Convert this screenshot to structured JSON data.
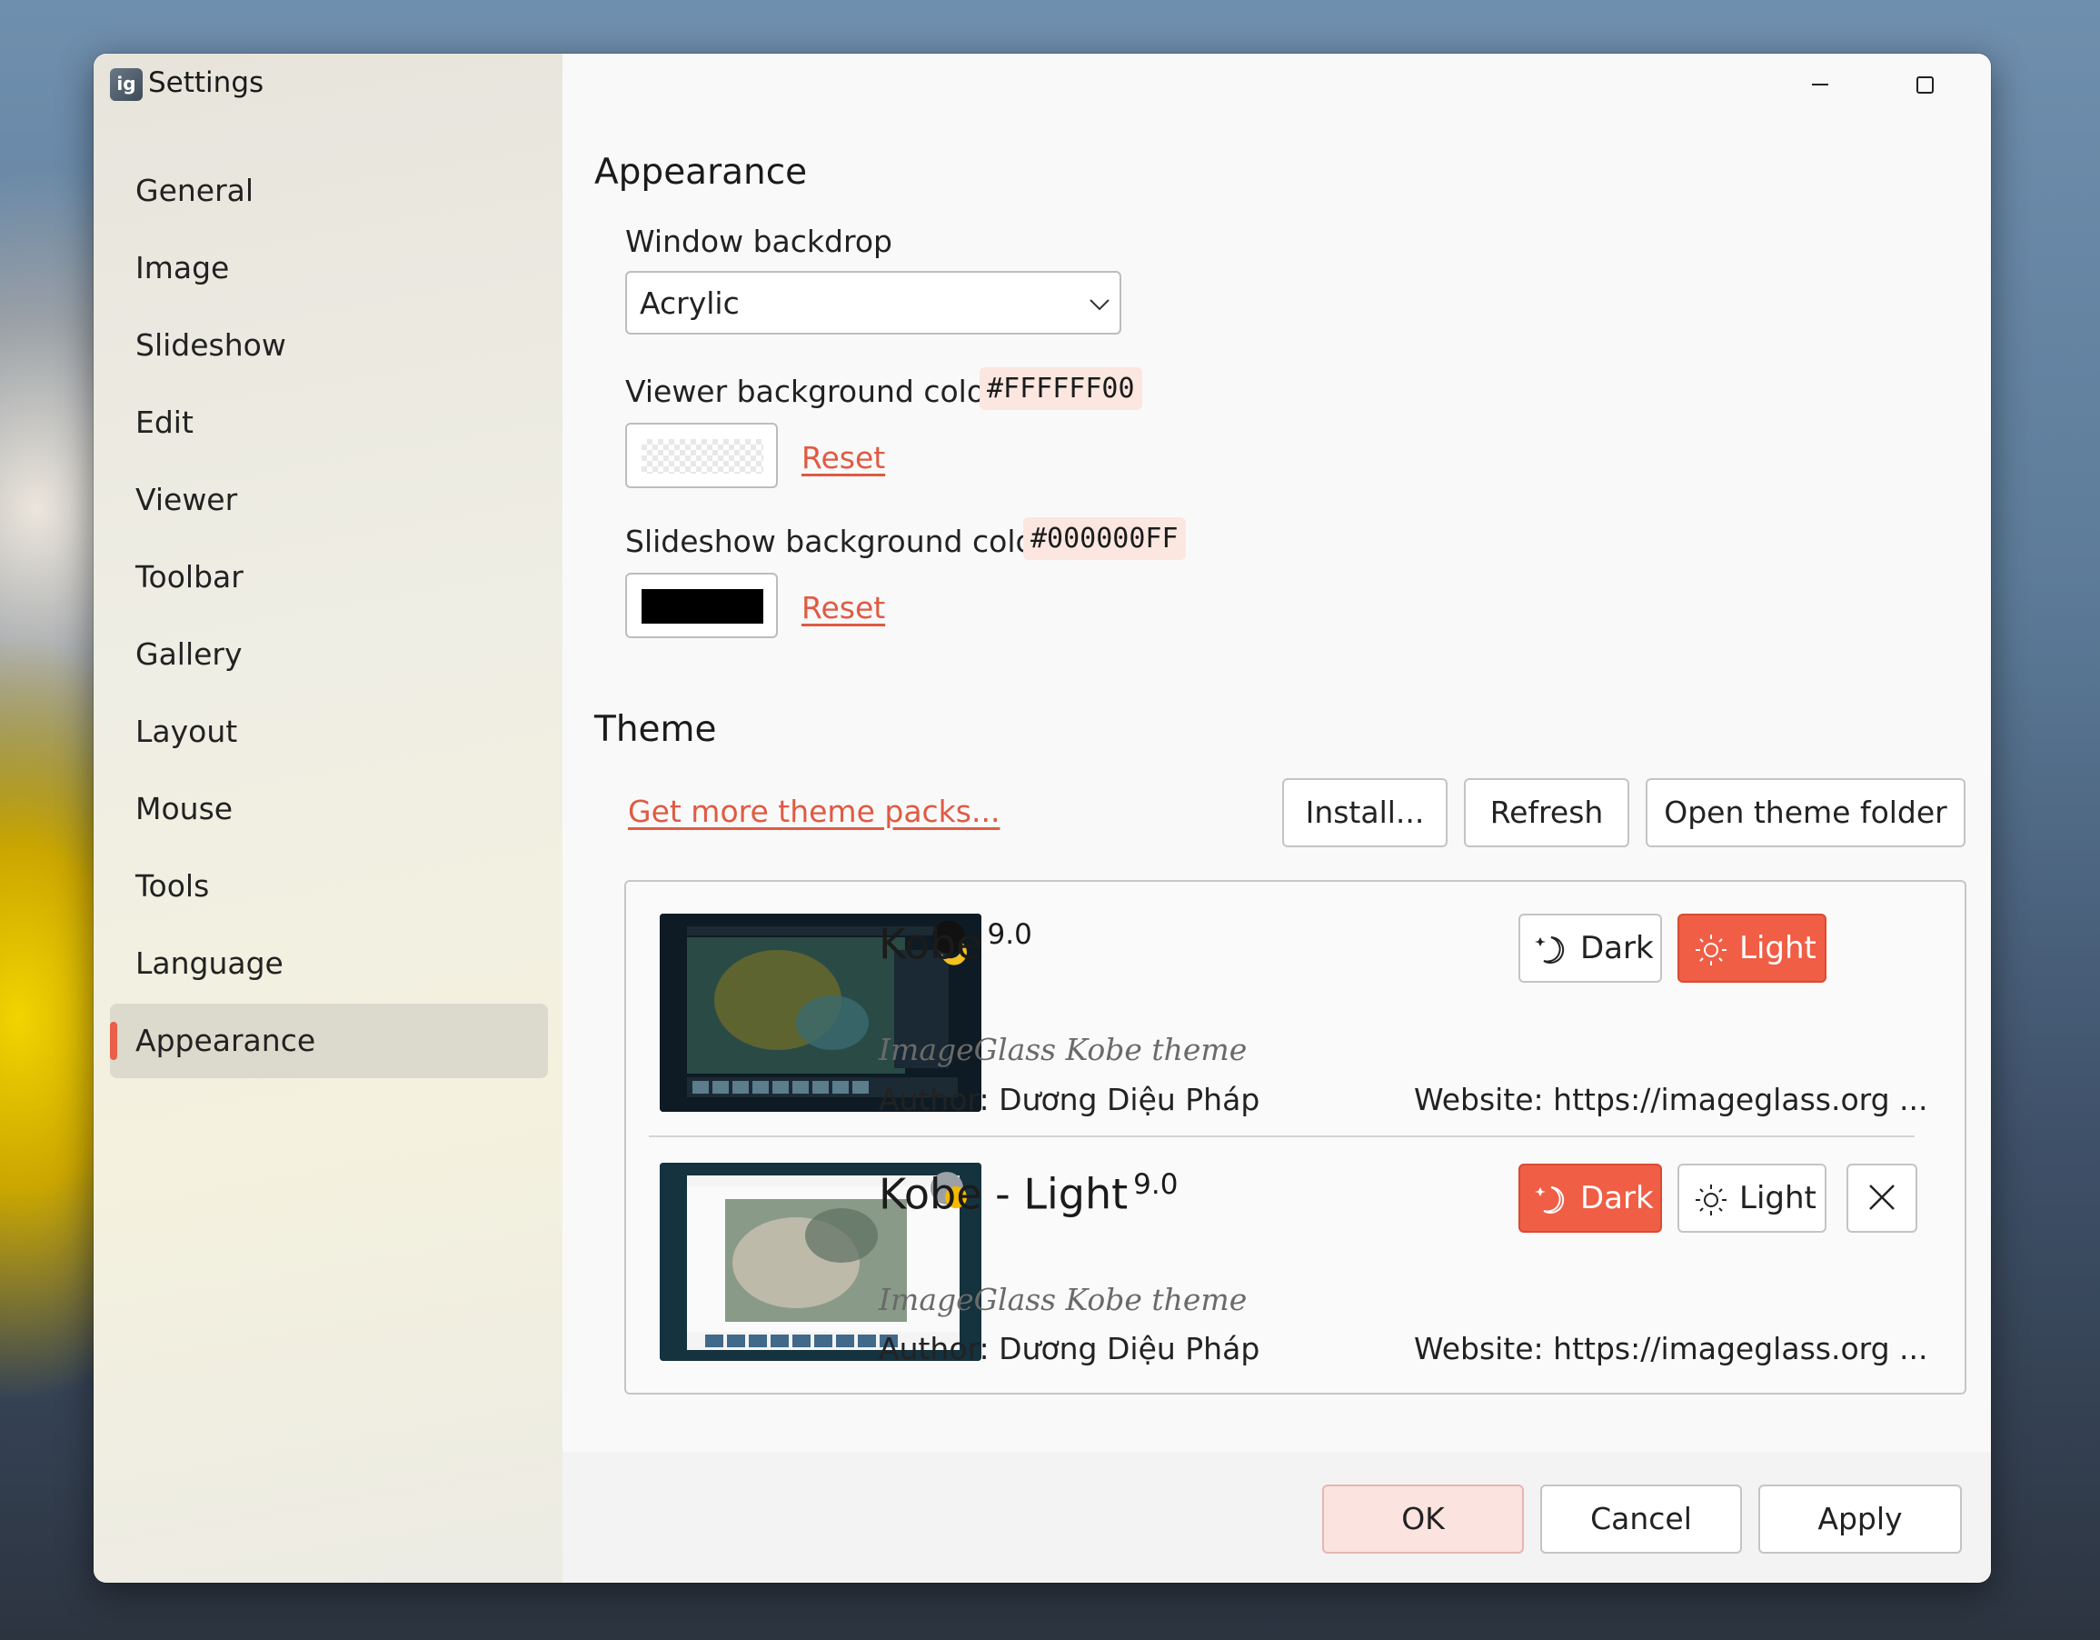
{
  "window": {
    "title": "Settings",
    "app_icon_text": "ig"
  },
  "sidebar": {
    "items": [
      {
        "label": "General"
      },
      {
        "label": "Image"
      },
      {
        "label": "Slideshow"
      },
      {
        "label": "Edit"
      },
      {
        "label": "Viewer"
      },
      {
        "label": "Toolbar"
      },
      {
        "label": "Gallery"
      },
      {
        "label": "Layout"
      },
      {
        "label": "Mouse"
      },
      {
        "label": "Tools"
      },
      {
        "label": "Language"
      },
      {
        "label": "Appearance",
        "active": true
      }
    ]
  },
  "appearance": {
    "heading": "Appearance",
    "backdrop_label": "Window backdrop",
    "backdrop_value": "Acrylic",
    "viewer_bg_label": "Viewer background color",
    "viewer_bg_value": "#FFFFFF00",
    "slideshow_bg_label": "Slideshow background color",
    "slideshow_bg_value": "#000000FF",
    "reset_label": "Reset"
  },
  "theme": {
    "heading": "Theme",
    "get_more_link": "Get more theme packs...",
    "install_button": "Install...",
    "refresh_button": "Refresh",
    "open_folder_button": "Open theme folder",
    "packs": [
      {
        "name": "Kobe",
        "version": "9.0",
        "description": "ImageGlass Kobe theme",
        "author": "Author: Dương Diệu Pháp",
        "website": "Website: https://imageglass.org ...",
        "dark_label": "Dark",
        "light_label": "Light",
        "active_mode": "light"
      },
      {
        "name": "Kobe - Light",
        "version": "9.0",
        "description": "ImageGlass Kobe theme",
        "author": "Author: Dương Diệu Pháp",
        "website": "Website: https://imageglass.org ...",
        "dark_label": "Dark",
        "light_label": "Light",
        "active_mode": "dark"
      }
    ]
  },
  "footer": {
    "ok": "OK",
    "cancel": "Cancel",
    "apply": "Apply"
  },
  "colors": {
    "accent": "#ef5e45",
    "link": "#e05a43",
    "ok_bg": "#fbe3df"
  }
}
